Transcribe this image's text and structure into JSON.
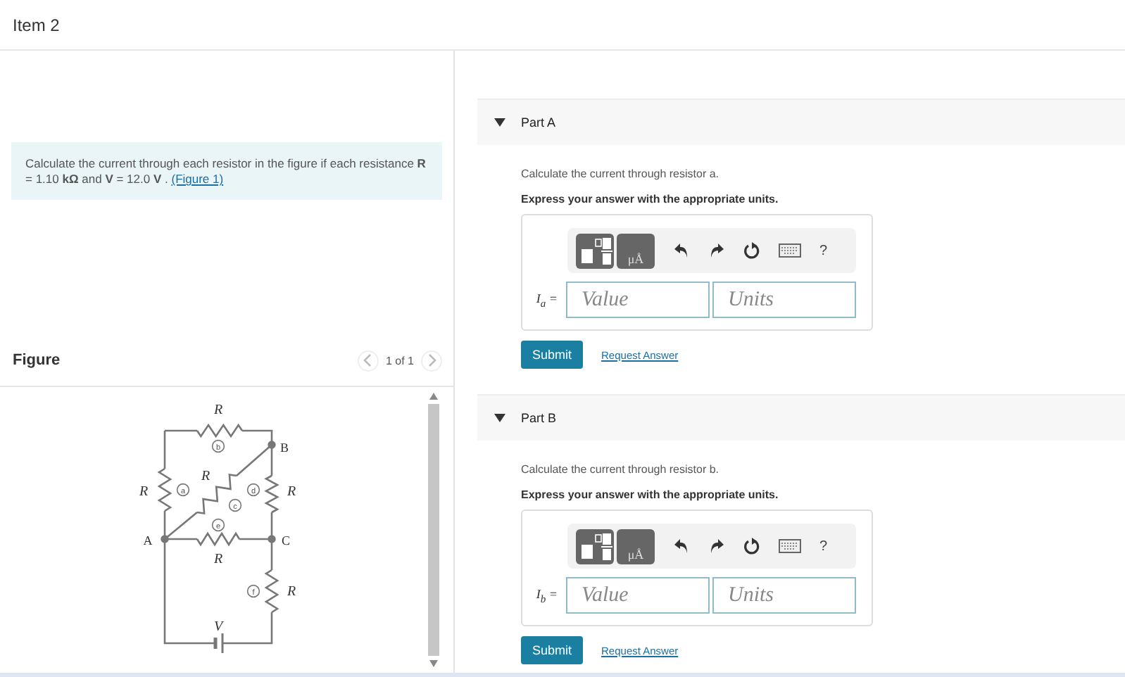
{
  "item_title": "Item 2",
  "problem": {
    "text": "Calculate the current through each resistor in the figure if each resistance **R** = 1.10 **kΩ** and **V** = 12.0 **V** .",
    "link": "(Figure 1)"
  },
  "figure": {
    "title": "Figure",
    "pager": "1 of 1",
    "circuit": {
      "resistors": [
        {
          "label": "R",
          "marker": "b"
        },
        {
          "label": "R",
          "marker": "a"
        },
        {
          "label": "R",
          "marker": "c"
        },
        {
          "label": "R",
          "marker": "d"
        },
        {
          "label": "R",
          "marker": "e"
        },
        {
          "label": "R",
          "marker": "f"
        }
      ],
      "nodes": [
        "A",
        "B",
        "C"
      ],
      "source": "V"
    }
  },
  "parts": [
    {
      "title": "Part A",
      "expanded": true,
      "prompt": "Calculate the current through resistor a.",
      "instruction": "Express your answer with the appropriate units.",
      "variable": "I$_{a}$ =",
      "units_key": "μÅ",
      "help": "?",
      "value_placeholder": "Value",
      "units_placeholder": "Units",
      "submit": "Submit",
      "request": "Request Answer"
    },
    {
      "title": "Part B",
      "expanded": true,
      "prompt": "Calculate the current through resistor b.",
      "instruction": "Express your answer with the appropriate units.",
      "variable": "I$_{b}$ =",
      "units_key": "μÅ",
      "help": "?",
      "value_placeholder": "Value",
      "units_placeholder": "Units",
      "submit": "Submit",
      "request": "Request Answer"
    }
  ]
}
